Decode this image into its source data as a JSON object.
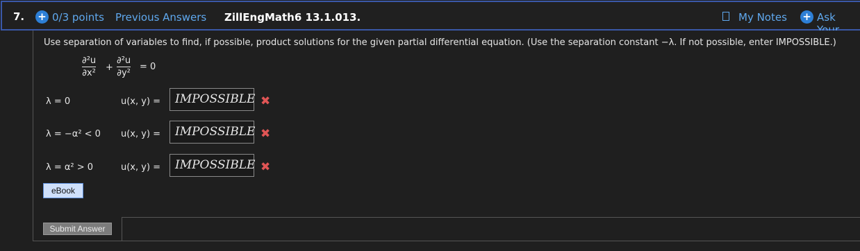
{
  "header": {
    "question_number": "7.",
    "points": "0/3 points",
    "previous_answers": "Previous Answers",
    "problem_id": "ZillEngMath6 13.1.013.",
    "my_notes": "My Notes",
    "ask_your": "Ask Your"
  },
  "prompt": "Use separation of variables to find, if possible, product solutions for the given partial differential equation. (Use the separation constant −λ. If not possible, enter IMPOSSIBLE.)",
  "equation": {
    "term1_num": "∂²u",
    "term1_den": "∂x²",
    "plus": "+",
    "term2_num": "∂²u",
    "term2_den": "∂y²",
    "rhs": "= 0"
  },
  "cases": [
    {
      "condition": "λ = 0",
      "label": "u(x, y) =",
      "answer": "IMPOSSIBLE",
      "status": "incorrect"
    },
    {
      "condition": "λ = −α² < 0",
      "label": "u(x, y) =",
      "answer": "IMPOSSIBLE",
      "status": "incorrect"
    },
    {
      "condition": "λ = α² > 0",
      "label": "u(x, y) =",
      "answer": "IMPOSSIBLE",
      "status": "incorrect"
    }
  ],
  "ebook_label": "eBook",
  "submit_label": "Submit Answer",
  "colors": {
    "accent": "#2d7fd6",
    "link": "#5fa8ee",
    "error": "#e05555",
    "border": "#3a58a8"
  }
}
